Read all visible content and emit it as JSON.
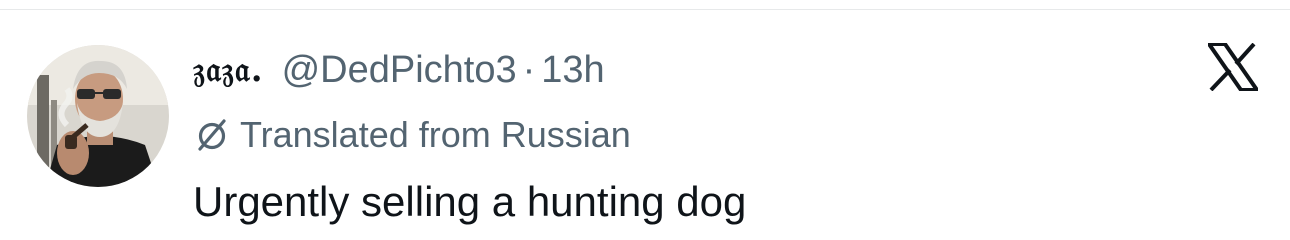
{
  "tweet": {
    "display_name": "𝔷𝔞𝔷𝔞.",
    "handle": "@DedPichto3",
    "separator": "·",
    "timestamp": "13h",
    "translated_label": "Translated from Russian",
    "text": "Urgently selling a hunting dog"
  },
  "icons": {
    "avatar": "avatar-photo-man-with-pipe-and-sunglasses",
    "translate": "translate-icon",
    "brand": "x-logo-icon"
  },
  "colors": {
    "primary_text": "#0f1419",
    "secondary_text": "#536471",
    "divider": "#e7e9ea"
  }
}
